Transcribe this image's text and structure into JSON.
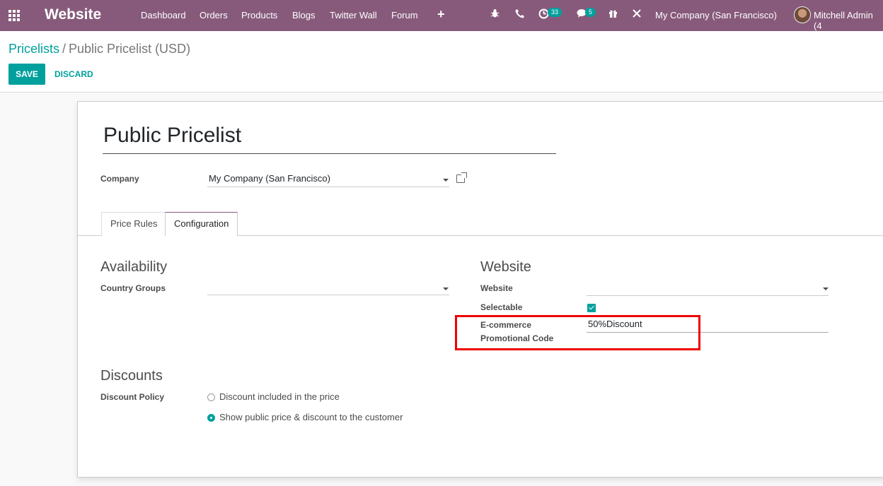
{
  "navbar": {
    "brand": "Website",
    "menu": [
      "Dashboard",
      "Orders",
      "Products",
      "Blogs",
      "Twitter Wall",
      "Forum"
    ],
    "add_icon": "+",
    "activity_badge": "33",
    "messages_badge": "5",
    "company": "My Company (San Francisco)",
    "user": "Mitchell Admin (4"
  },
  "breadcrumb": {
    "parent": "Pricelists",
    "separator": "/",
    "current": "Public Pricelist (USD)"
  },
  "buttons": {
    "save": "SAVE",
    "discard": "DISCARD"
  },
  "form": {
    "name": "Public Pricelist",
    "company_label": "Company",
    "company_value": "My Company (San Francisco)",
    "tabs": [
      "Price Rules",
      "Configuration"
    ],
    "availability_title": "Availability",
    "country_groups_label": "Country Groups",
    "country_groups_value": "",
    "website_title": "Website",
    "website_label": "Website",
    "website_value": "",
    "selectable_label": "Selectable",
    "selectable_checked": true,
    "promo_label_line1": "E-commerce",
    "promo_label_line2": "Promotional Code",
    "promo_value": "50%Discount",
    "discounts_title": "Discounts",
    "discount_policy_label": "Discount Policy",
    "discount_options": [
      "Discount included in the price",
      "Show public price & discount to the customer"
    ],
    "discount_selected": 1
  },
  "colors": {
    "navbar": "#875a7b",
    "primary": "#00a09d",
    "highlight": "#e00000"
  }
}
